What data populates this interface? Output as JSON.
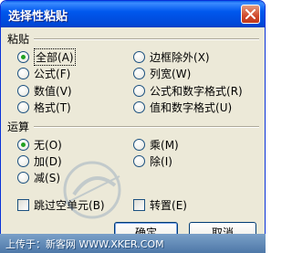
{
  "window": {
    "title": "选择性粘贴"
  },
  "paste": {
    "label": "粘贴",
    "options": [
      {
        "label": "全部",
        "key": "(A)"
      },
      {
        "label": "公式",
        "key": "(F)"
      },
      {
        "label": "数值",
        "key": "(V)"
      },
      {
        "label": "格式",
        "key": "(T)"
      },
      {
        "label": "边框除外",
        "key": "(X)"
      },
      {
        "label": "列宽",
        "key": "(W)"
      },
      {
        "label": "公式和数字格式",
        "key": "(R)"
      },
      {
        "label": "值和数字格式",
        "key": "(U)"
      }
    ],
    "selected": "全部"
  },
  "operation": {
    "label": "运算",
    "options": [
      {
        "label": "无",
        "key": "(O)"
      },
      {
        "label": "加",
        "key": "(D)"
      },
      {
        "label": "减",
        "key": "(S)"
      },
      {
        "label": "乘",
        "key": "(M)"
      },
      {
        "label": "除",
        "key": "(I)"
      }
    ],
    "selected": "无"
  },
  "checkboxes": {
    "skip_blanks": {
      "label": "跳过空单元",
      "key": "(B)",
      "checked": false
    },
    "transpose": {
      "label": "转置",
      "key": "(E)",
      "checked": false
    }
  },
  "buttons": {
    "ok": "确定",
    "cancel": "取消"
  },
  "footer": {
    "text": "上传于：新客网 WWW.XKER.COM"
  },
  "icons": {
    "close": "close-icon",
    "watermark": "watermark-logo"
  }
}
